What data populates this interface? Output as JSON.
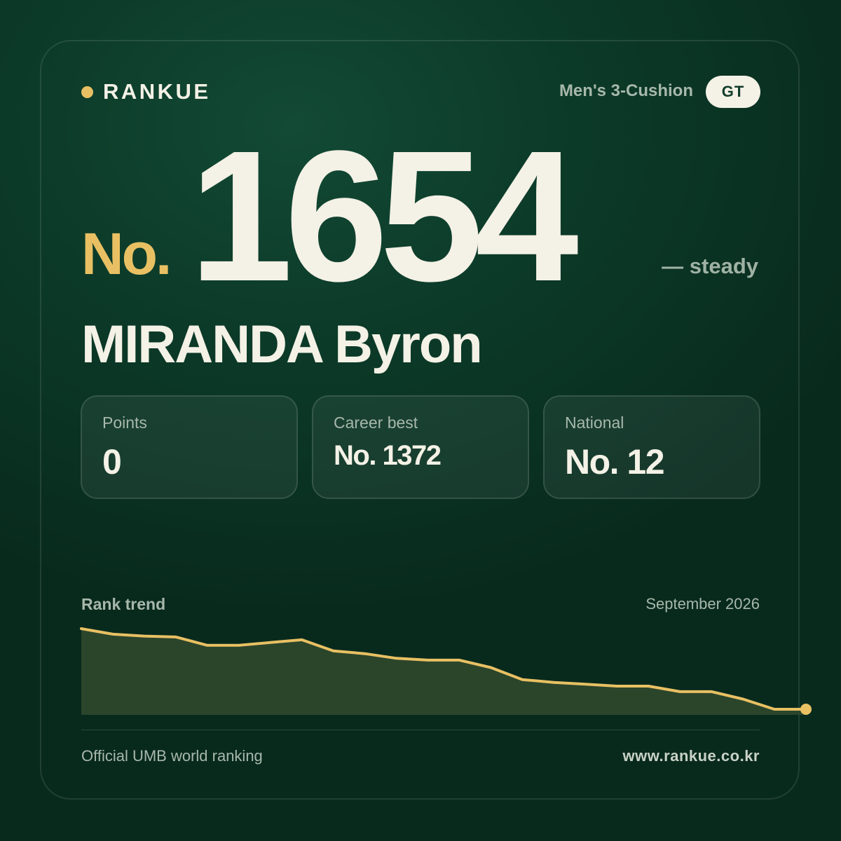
{
  "brand": {
    "name": "RANKUE",
    "dot_color": "#e8c063"
  },
  "header": {
    "discipline": "Men's 3-Cushion",
    "country_code": "GT"
  },
  "rank": {
    "prefix": "No.",
    "number": "1654",
    "change": "— steady"
  },
  "player": {
    "name": "MIRANDA Byron"
  },
  "stats": [
    {
      "label": "Points",
      "value": "0"
    },
    {
      "label": "Career best",
      "value": "No. 1372"
    },
    {
      "label": "National",
      "value": "No. 12"
    }
  ],
  "trend": {
    "label": "Rank trend",
    "period": "September 2026",
    "line_color": "#e8c063",
    "fill_color": "#2b452b"
  },
  "chart_data": {
    "type": "area",
    "title": "Rank trend",
    "xlabel": "",
    "ylabel": "",
    "grid": false,
    "values": [
      12,
      9,
      8,
      7.5,
      3,
      3,
      4.5,
      6,
      0,
      -1.5,
      -4,
      -5,
      -5,
      -9,
      -15.5,
      -17,
      -18,
      -19,
      -19,
      -22,
      -22,
      -26,
      -31.5,
      -31.5
    ]
  },
  "colors": {
    "accent": "#e8c063",
    "text": "#f4f1e6",
    "muted": "#a7b8ab",
    "background": "#0c3a28"
  },
  "footer": {
    "source": "Official UMB world ranking",
    "url": "www.rankue.co.kr"
  }
}
